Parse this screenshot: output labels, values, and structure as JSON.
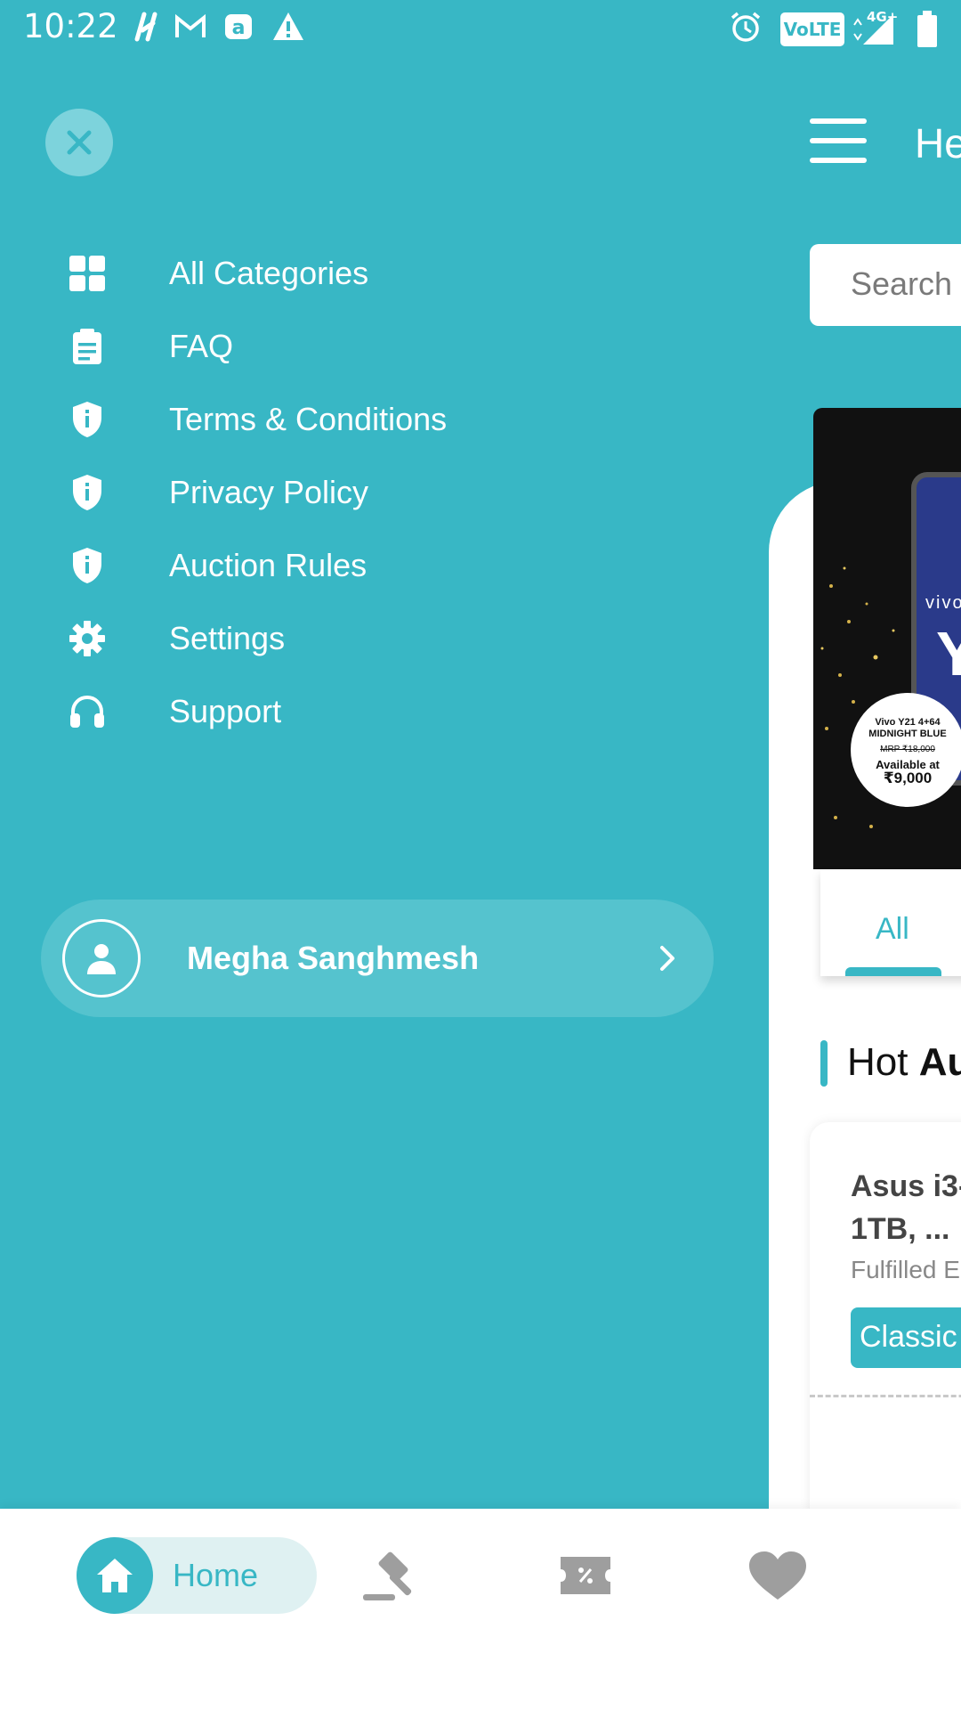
{
  "status_bar": {
    "time": "10:22",
    "volte": "VoLTE",
    "network": "4G+"
  },
  "drawer": {
    "menu": [
      {
        "label": "All Categories",
        "icon": "grid-icon"
      },
      {
        "label": "FAQ",
        "icon": "clipboard-icon"
      },
      {
        "label": "Terms & Conditions",
        "icon": "shield-info-icon"
      },
      {
        "label": "Privacy Policy",
        "icon": "shield-info-icon"
      },
      {
        "label": "Auction Rules",
        "icon": "shield-info-icon"
      },
      {
        "label": "Settings",
        "icon": "gear-icon"
      },
      {
        "label": "Support",
        "icon": "headphones-icon"
      }
    ],
    "profile": {
      "name": "Megha Sanghmesh"
    }
  },
  "page": {
    "title": "He",
    "search_placeholder": "Search f",
    "banner": {
      "brand": "vivo",
      "model_letter": "Y",
      "badge_line1": "Vivo Y21 4+64",
      "badge_line2": "MIDNIGHT BLUE",
      "badge_mrp": "MRP ₹18,000",
      "badge_available": "Available at",
      "badge_price": "₹9,000"
    },
    "tab_all": "All",
    "section_title_prefix": "Hot ",
    "section_title_bold": "Au",
    "product": {
      "name": "Asus i3-\n1TB, ...",
      "subtitle": "Fulfilled E",
      "tag": "Classic"
    }
  },
  "bottom_nav": {
    "home_label": "Home"
  },
  "colors": {
    "primary": "#38b7c5",
    "drawer_bg": "#38b7c5",
    "close_bg": "#7dd3dc",
    "profile_bg": "#55c3ce",
    "nav_icon": "#9e9e9e"
  }
}
